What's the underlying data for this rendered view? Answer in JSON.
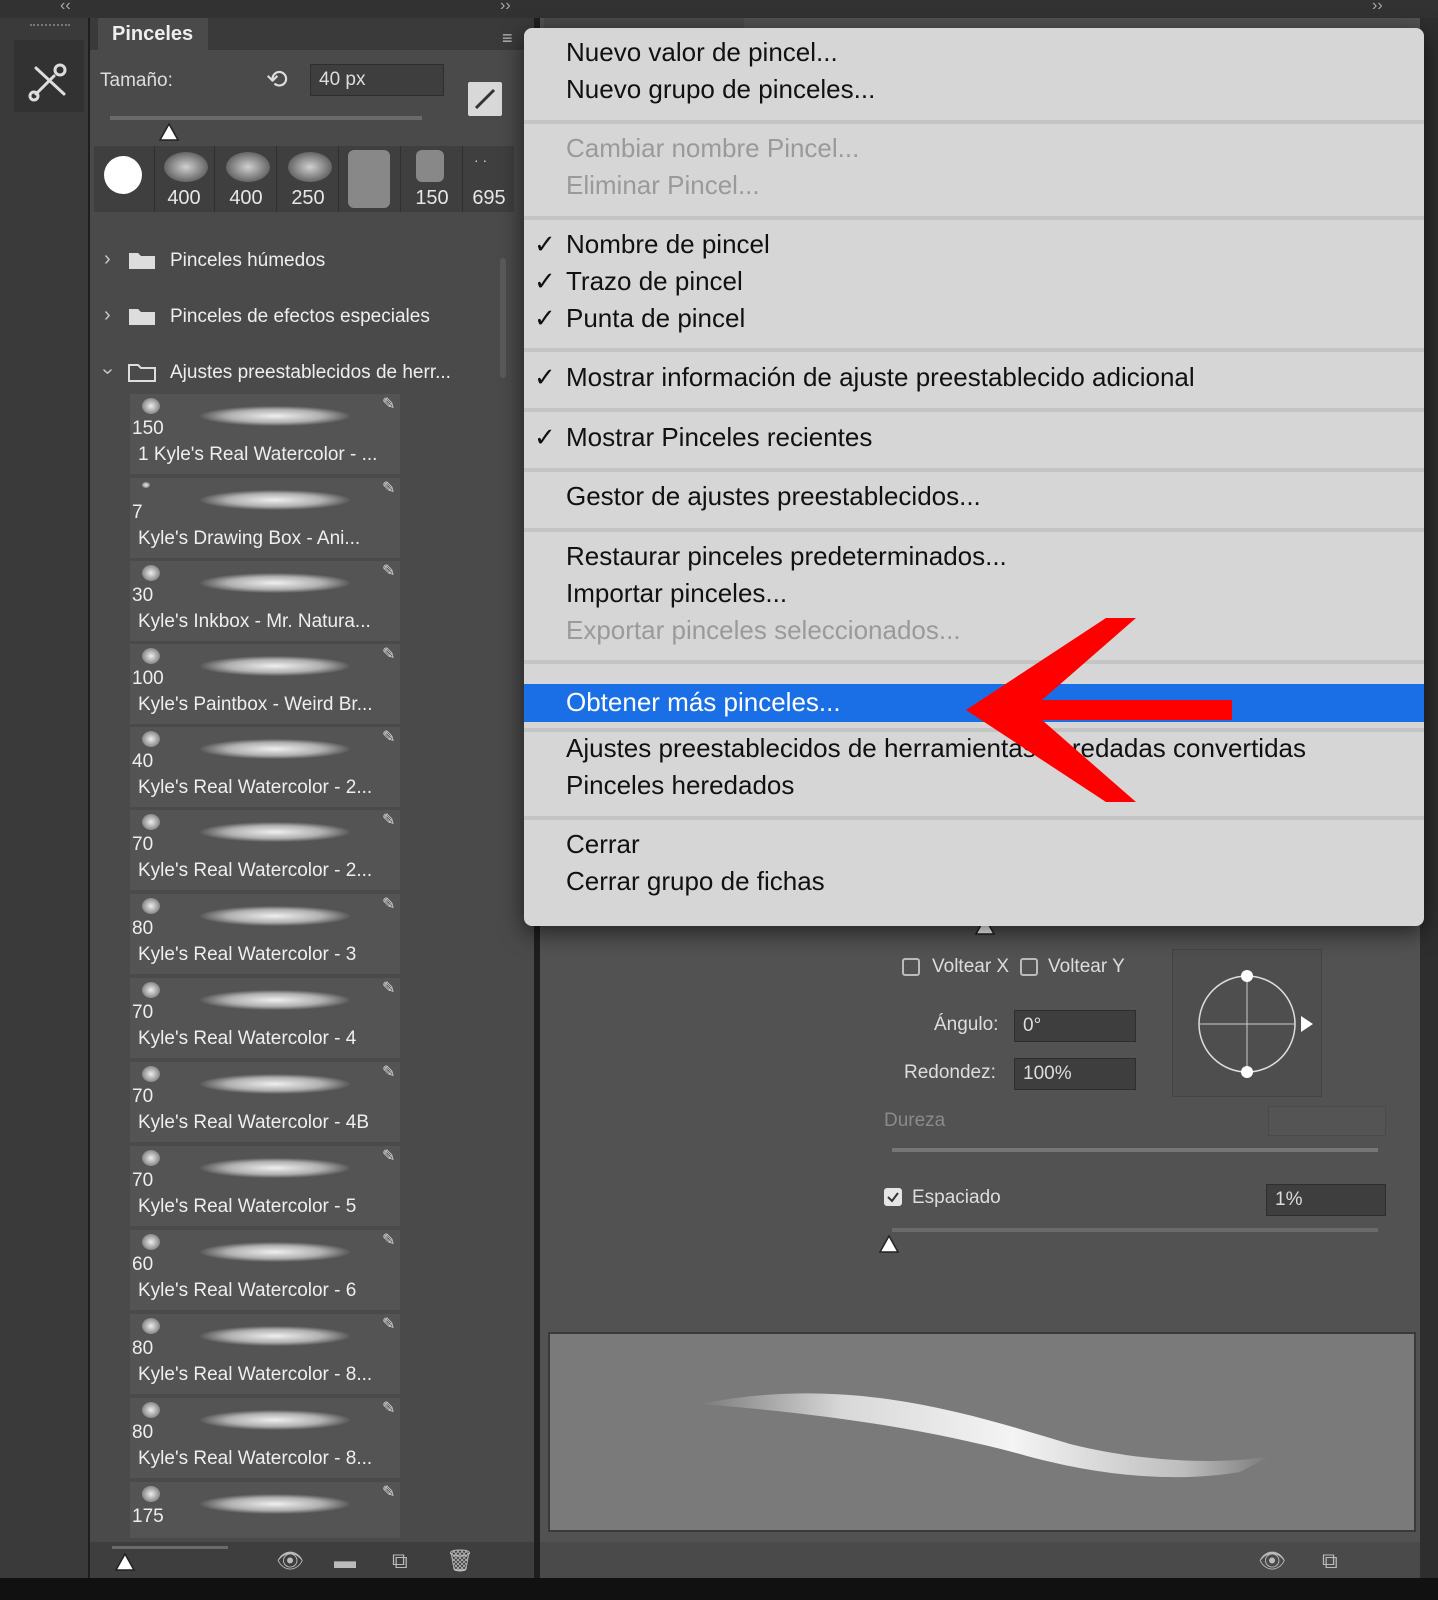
{
  "panel": {
    "tab_label": "Pinceles",
    "size_label": "Tamaño:",
    "size_value": "40 px",
    "recent_brushes": [
      "400",
      "400",
      "250",
      "",
      "150",
      "695"
    ],
    "folders": [
      {
        "name": "Pinceles húmedos",
        "expanded": false
      },
      {
        "name": "Pinceles de efectos especiales",
        "expanded": false
      },
      {
        "name": "Ajustes preestablecidos de herr...",
        "expanded": true
      }
    ],
    "brushes": [
      {
        "size": "150",
        "name": "1 Kyle's Real Watercolor - ..."
      },
      {
        "size": "7",
        "name": "Kyle's Drawing Box - Ani..."
      },
      {
        "size": "30",
        "name": "Kyle's Inkbox - Mr. Natura..."
      },
      {
        "size": "100",
        "name": "Kyle's Paintbox - Weird Br..."
      },
      {
        "size": "40",
        "name": "Kyle's Real Watercolor - 2..."
      },
      {
        "size": "70",
        "name": "Kyle's Real Watercolor - 2..."
      },
      {
        "size": "80",
        "name": "Kyle's Real Watercolor - 3"
      },
      {
        "size": "70",
        "name": "Kyle's Real Watercolor - 4"
      },
      {
        "size": "70",
        "name": "Kyle's Real Watercolor - 4B"
      },
      {
        "size": "70",
        "name": "Kyle's Real Watercolor - 5"
      },
      {
        "size": "60",
        "name": "Kyle's Real Watercolor - 6"
      },
      {
        "size": "80",
        "name": "Kyle's Real Watercolor - 8..."
      },
      {
        "size": "80",
        "name": "Kyle's Real Watercolor - 8..."
      },
      {
        "size": "175",
        "name": ""
      }
    ]
  },
  "settings": {
    "flip_x": "Voltear X",
    "flip_y": "Voltear Y",
    "angle_label": "Ángulo:",
    "angle_value": "0°",
    "roundness_label": "Redondez:",
    "roundness_value": "100%",
    "hardness_label": "Dureza",
    "spacing_label": "Espaciado",
    "spacing_value": "1%",
    "spacing_checked": true
  },
  "menu": {
    "items": [
      {
        "label": "Nuevo valor de pincel...",
        "checked": false,
        "disabled": false
      },
      {
        "label": "Nuevo grupo de pinceles...",
        "checked": false,
        "disabled": false
      },
      {
        "label": "Cambiar nombre Pincel...",
        "checked": false,
        "disabled": true
      },
      {
        "label": "Eliminar Pincel...",
        "checked": false,
        "disabled": true
      },
      {
        "label": "Nombre de pincel",
        "checked": true,
        "disabled": false
      },
      {
        "label": "Trazo de pincel",
        "checked": true,
        "disabled": false
      },
      {
        "label": "Punta de pincel",
        "checked": true,
        "disabled": false
      },
      {
        "label": "Mostrar información de ajuste preestablecido adicional",
        "checked": true,
        "disabled": false
      },
      {
        "label": "Mostrar Pinceles recientes",
        "checked": true,
        "disabled": false
      },
      {
        "label": "Gestor de ajustes preestablecidos...",
        "checked": false,
        "disabled": false
      },
      {
        "label": "Restaurar pinceles predeterminados...",
        "checked": false,
        "disabled": false
      },
      {
        "label": "Importar pinceles...",
        "checked": false,
        "disabled": false
      },
      {
        "label": "Exportar pinceles seleccionados...",
        "checked": false,
        "disabled": true
      },
      {
        "label": "Obtener más pinceles...",
        "checked": false,
        "disabled": false,
        "highlighted": true
      },
      {
        "label": "Ajustes preestablecidos de herramientas heredadas convertidas",
        "checked": false,
        "disabled": false
      },
      {
        "label": "Pinceles heredados",
        "checked": false,
        "disabled": false
      },
      {
        "label": "Cerrar",
        "checked": false,
        "disabled": false
      },
      {
        "label": "Cerrar grupo de fichas",
        "checked": false,
        "disabled": false
      }
    ],
    "check_glyph": "✓"
  },
  "colors": {
    "highlight": "#1a6fe6",
    "annotation_arrow": "#ff0000",
    "menu_bg": "#d6d6d6",
    "panel_bg": "#4a4a4a"
  }
}
